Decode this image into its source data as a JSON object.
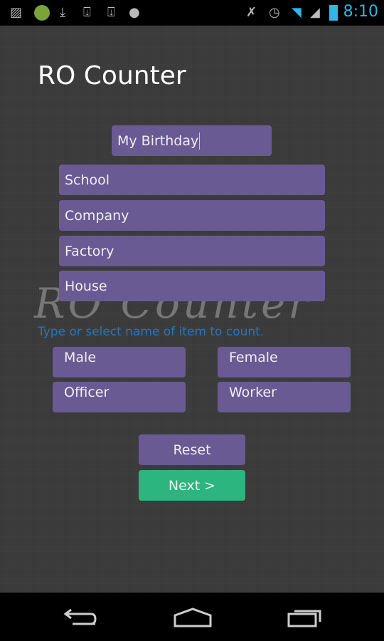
{
  "status_bar": {
    "time": "8:10",
    "left_icons": [
      "gallery-icon",
      "app-icon",
      "download-icon",
      "download-icon",
      "download-icon",
      "android-icon"
    ],
    "right_icons": [
      "mute-icon",
      "alarm-icon",
      "wifi-icon",
      "signal-icon",
      "battery-charging-icon"
    ]
  },
  "app": {
    "title": "RO Counter",
    "watermark": "RO Counter"
  },
  "name_input": {
    "value": "My Birthday"
  },
  "suggestions": [
    "School",
    "Company",
    "Factory",
    "House"
  ],
  "hint": "Type or select name of item to count.",
  "options": [
    "Male",
    "Female",
    "Officer",
    "Worker"
  ],
  "buttons": {
    "reset": "Reset",
    "next": "Next >"
  },
  "colors": {
    "accent": "#6a5a94",
    "next": "#2db57f",
    "hint": "#2a74b8",
    "background": "#3b3b3b"
  },
  "nav": [
    "back-icon",
    "home-icon",
    "recent-apps-icon"
  ]
}
